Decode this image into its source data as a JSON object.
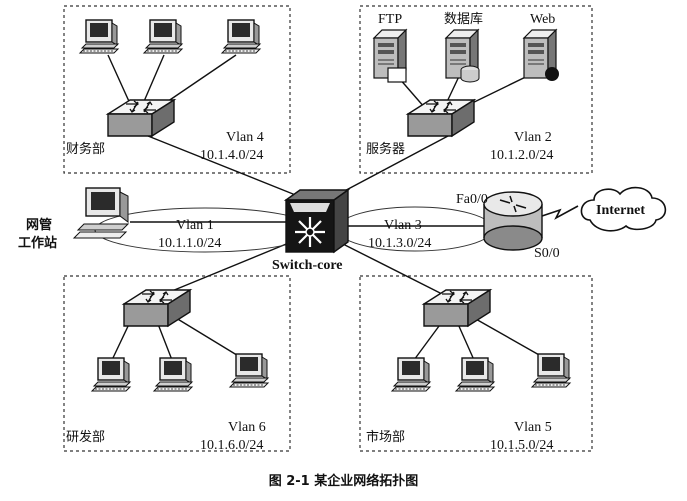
{
  "departments": {
    "finance": {
      "name": "财务部",
      "vlan": "Vlan 4",
      "subnet": "10.1.4.0/24"
    },
    "servers": {
      "name": "服务器",
      "vlan": "Vlan 2",
      "subnet": "10.1.2.0/24"
    },
    "rnd": {
      "name": "研发部",
      "vlan": "Vlan 6",
      "subnet": "10.1.6.0/24"
    },
    "market": {
      "name": "市场部",
      "vlan": "Vlan 5",
      "subnet": "10.1.5.0/24"
    }
  },
  "servers": {
    "ftp": "FTP",
    "db": "数据库",
    "web": "Web"
  },
  "mgmt": {
    "line1": "网管",
    "line2": "工作站",
    "vlan": "Vlan 1",
    "subnet": "10.1.1.0/24"
  },
  "core": {
    "name": "Switch-core"
  },
  "router": {
    "vlan": "Vlan 3",
    "subnet": "10.1.3.0/24",
    "port_in": "Fa0/0",
    "port_out": "S0/0"
  },
  "internet": "Internet",
  "caption": "图 2-1  某企业网络拓扑图"
}
